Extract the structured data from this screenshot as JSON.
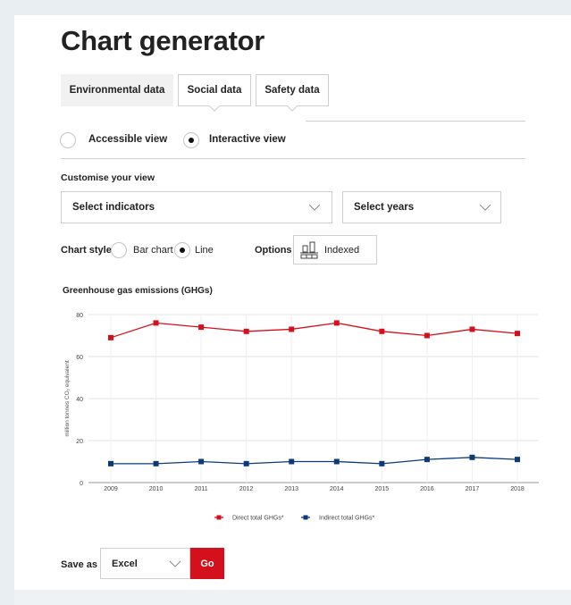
{
  "page": {
    "title": "Chart generator"
  },
  "tabs": [
    {
      "label": "Environmental data",
      "active": true
    },
    {
      "label": "Social data",
      "active": false
    },
    {
      "label": "Safety data",
      "active": false
    }
  ],
  "view_toggle": {
    "accessible": "Accessible view",
    "interactive": "Interactive view",
    "selected": "interactive"
  },
  "customise": {
    "heading": "Customise your view",
    "indicators_placeholder": "Select indicators",
    "years_placeholder": "Select years"
  },
  "chart_style": {
    "label": "Chart style",
    "bar": "Bar chart",
    "line": "Line",
    "selected": "line"
  },
  "options": {
    "label": "Options",
    "indexed": "Indexed",
    "icon": "indexed-chart-icon"
  },
  "colors": {
    "direct": "#d4101c",
    "indirect": "#0d3b78",
    "go_button": "#d4101c"
  },
  "chart_data": {
    "type": "line",
    "title": "Greenhouse gas emissions (GHGs)",
    "ylabel": "million tonnes CO₂ equivalent",
    "xlabel": "",
    "x": [
      "2009",
      "2010",
      "2011",
      "2012",
      "2013",
      "2014",
      "2015",
      "2016",
      "2017",
      "2018"
    ],
    "ylim": [
      0,
      80
    ],
    "yticks": [
      0,
      20,
      40,
      60,
      80
    ],
    "grid": true,
    "legend_position": "bottom",
    "series": [
      {
        "name": "Direct total GHGs*",
        "color": "#d4101c",
        "values": [
          69,
          76,
          74,
          72,
          73,
          76,
          72,
          70,
          73,
          71
        ]
      },
      {
        "name": "Indirect total GHGs*",
        "color": "#0d3b78",
        "values": [
          9,
          9,
          10,
          9,
          10,
          10,
          9,
          11,
          12,
          11
        ]
      }
    ]
  },
  "save": {
    "label": "Save as",
    "format": "Excel",
    "go": "Go"
  }
}
